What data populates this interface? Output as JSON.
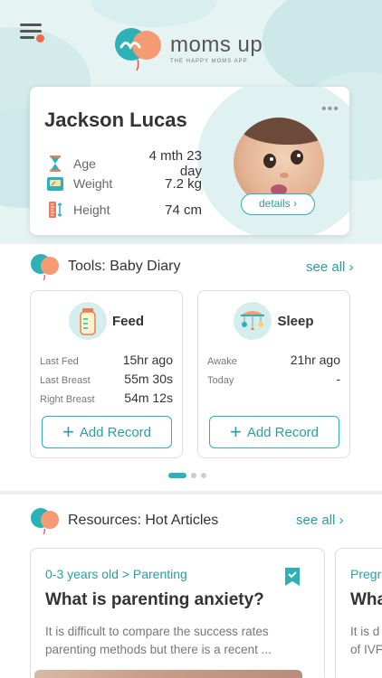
{
  "app": {
    "logo_text": "moms up",
    "logo_tagline": "THE HAPPY MOMS APP",
    "colors": {
      "accent": "#2bb1b6",
      "coral": "#f06a4a",
      "header_bg": "#e6f3f3"
    }
  },
  "header": {
    "menu_icon": "hamburger-menu-icon"
  },
  "profile": {
    "name": "Jackson Lucas",
    "more_icon": "more-dots-icon",
    "stats": [
      {
        "icon": "hourglass-icon",
        "label": "Age",
        "value": "4 mth 23 day"
      },
      {
        "icon": "scale-icon",
        "label": "Weight",
        "value": "7.2 kg"
      },
      {
        "icon": "ruler-icon",
        "label": "Height",
        "value": "74 cm"
      }
    ],
    "details_label": "details ›"
  },
  "tools": {
    "title": "Tools: Baby Diary",
    "see_all": "see all ›",
    "cards": [
      {
        "icon": "baby-bottle-icon",
        "title": "Feed",
        "rows": [
          {
            "key": "Last Fed",
            "value": "15hr ago"
          },
          {
            "key": "Last Breast",
            "value": "55m 30s"
          },
          {
            "key": "Right Breast",
            "value": "54m 12s"
          }
        ],
        "button": "Add Record"
      },
      {
        "icon": "crib-mobile-icon",
        "title": "Sleep",
        "rows": [
          {
            "key": "Awake",
            "value": "21hr ago"
          },
          {
            "key": "Today",
            "value": "-"
          }
        ],
        "button": "Add Record"
      }
    ],
    "pager": {
      "current": 1,
      "total": 3
    }
  },
  "resources": {
    "title": "Resources: Hot Articles",
    "see_all": "see all ›",
    "articles": [
      {
        "category": "0-3 years old > Parenting",
        "title": "What is parenting anxiety?",
        "desc_line1": "It is difficult to compare the success rates",
        "desc_line2": "parenting methods but there is a recent ...",
        "bookmark_icon": "bookmark-icon"
      },
      {
        "category": "Pregr",
        "title": "Wha",
        "desc_line1": "It is d",
        "desc_line2": "of IVF"
      }
    ]
  }
}
